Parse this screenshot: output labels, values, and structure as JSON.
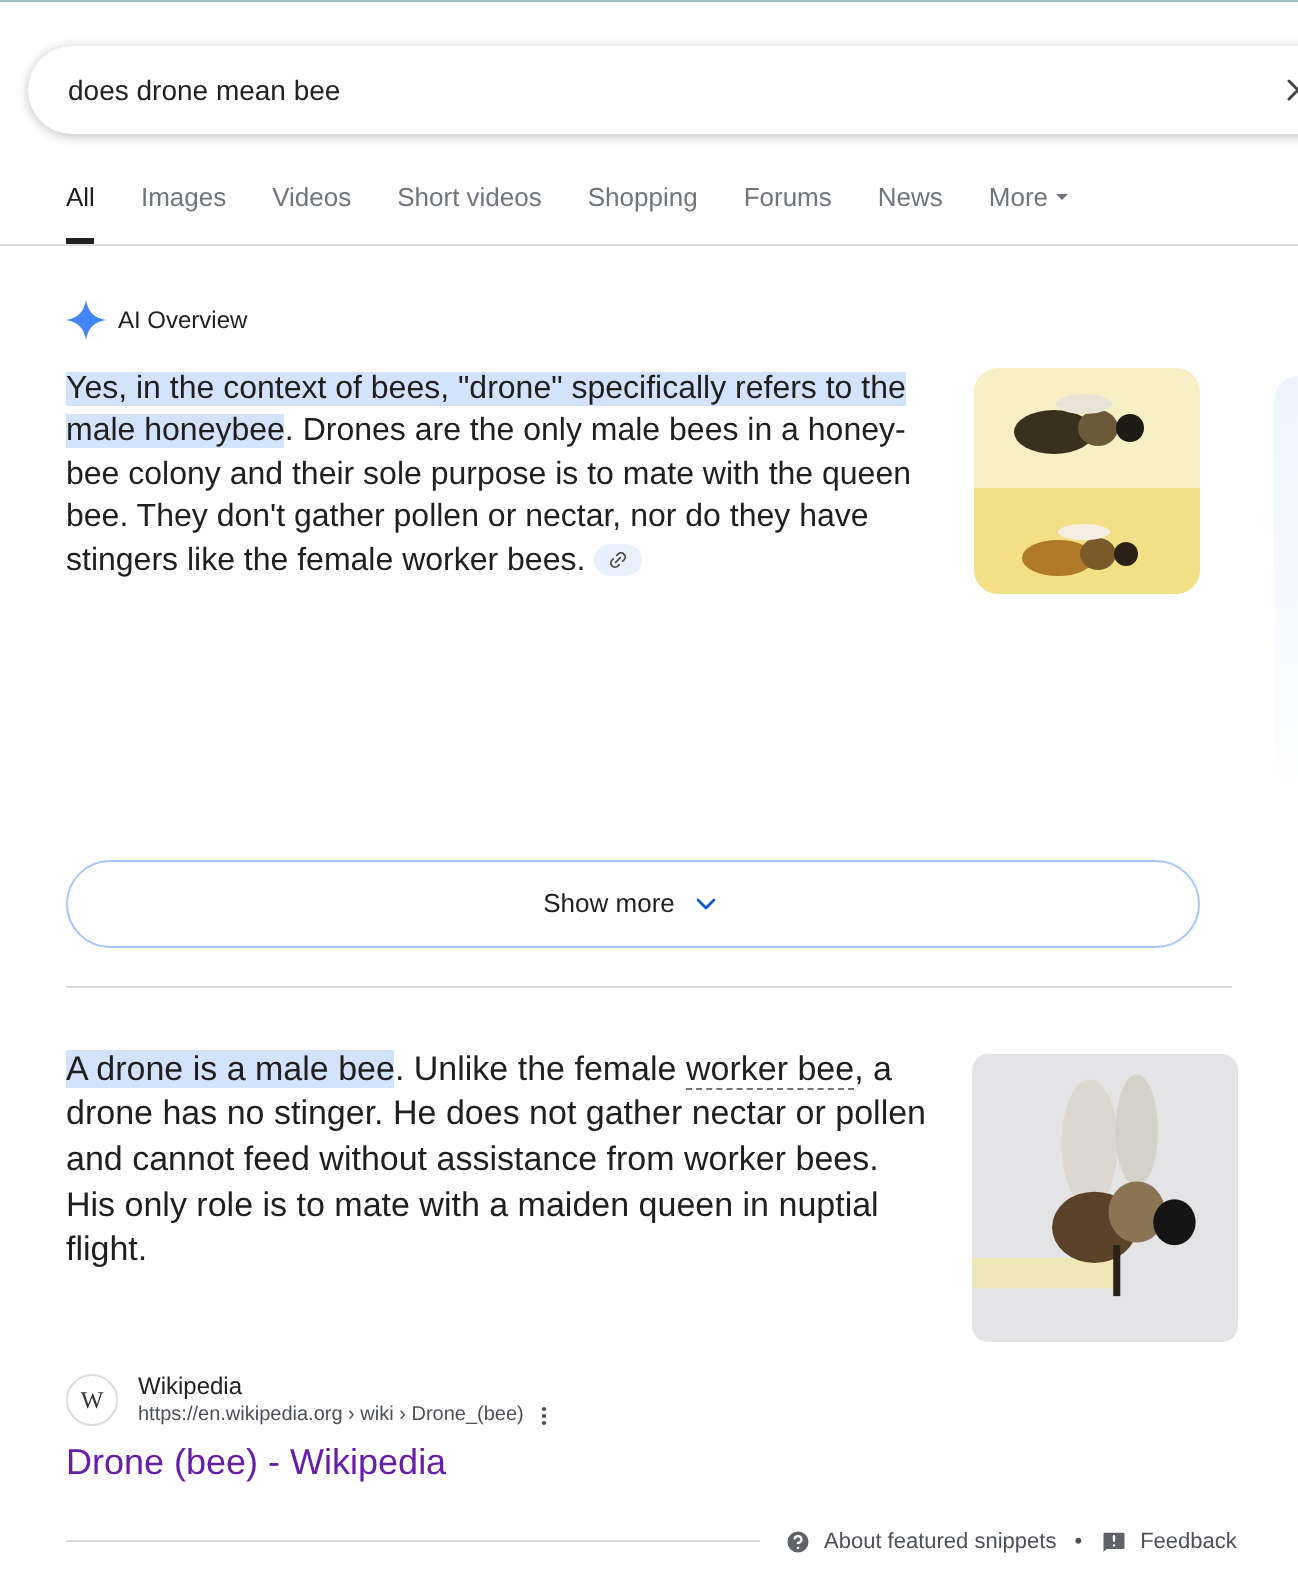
{
  "search": {
    "value": "does drone mean bee"
  },
  "tabs": [
    {
      "label": "All",
      "selected": true
    },
    {
      "label": "Images",
      "selected": false
    },
    {
      "label": "Videos",
      "selected": false
    },
    {
      "label": "Short videos",
      "selected": false
    },
    {
      "label": "Shopping",
      "selected": false
    },
    {
      "label": "Forums",
      "selected": false
    },
    {
      "label": "News",
      "selected": false
    },
    {
      "label": "More",
      "selected": false,
      "kind": "menu"
    }
  ],
  "ai_overview": {
    "title": "AI Overview",
    "highlight": "Yes, in the context of bees, \"drone\" specifically refers to the male honeybee",
    "text": ". Drones are the only male bees in a honey-bee colony and their sole purpose is to mate with the queen bee. They don't gather pollen or nectar, nor do they have stingers like the female worker bees.",
    "show_more": "Show more"
  },
  "snippet": {
    "highlight": "A drone is a male bee",
    "text_before_link": ". Unlike the female ",
    "link": "worker bee",
    "text_after_link": ", a drone has no stinger. He does not gather nectar or pollen and cannot feed without assistance from worker bees. His only role is to mate with a maiden queen in nuptial flight.",
    "source": {
      "logo": "W",
      "name": "Wikipedia",
      "url": "https://en.wikipedia.org › wiki › Drone_(bee)"
    },
    "title": "Drone (bee) - Wikipedia"
  },
  "footer": {
    "about": "About featured snippets",
    "separator": "•",
    "feedback": "Feedback"
  }
}
